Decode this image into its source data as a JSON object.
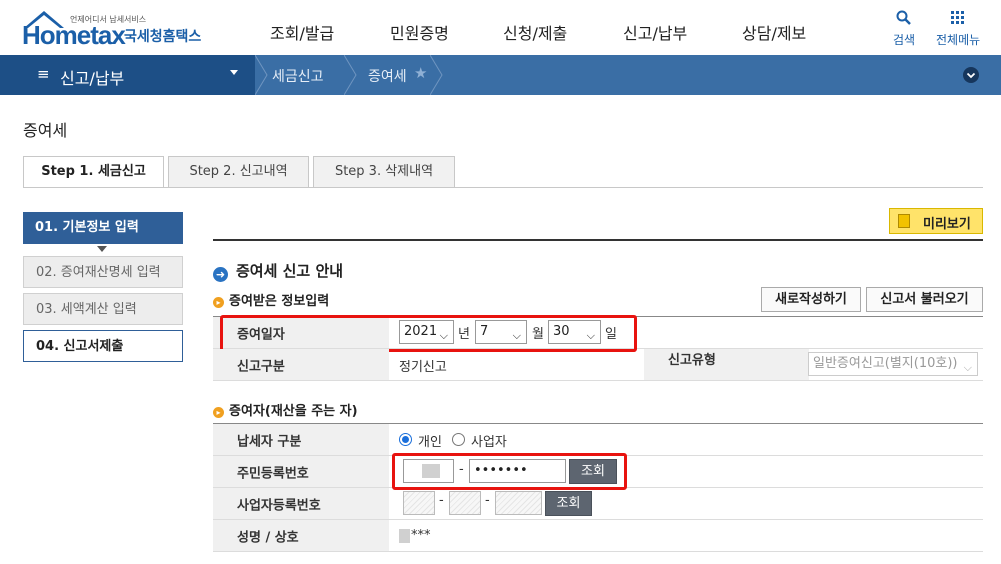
{
  "header": {
    "logo_small": "언제어디서 납세서비스",
    "logo_main": "Hometax",
    "logo_kr": "국세청홈택스",
    "gnb": [
      "조회/발급",
      "민원증명",
      "신청/제출",
      "신고/납부",
      "상담/제보"
    ],
    "search_label": "검색",
    "allmenu_label": "전체메뉴"
  },
  "navbar": {
    "menu_label": "신고/납부",
    "crumb1": "세금신고",
    "crumb2": "증여세"
  },
  "page": {
    "title": "증여세",
    "tabs": [
      "Step 1. 세금신고",
      "Step 2. 신고내역",
      "Step 3. 삭제내역"
    ]
  },
  "steps": [
    "01. 기본정보 입력",
    "02. 증여재산명세 입력",
    "03. 세액계산 입력",
    "04. 신고서제출"
  ],
  "preview_label": "미리보기",
  "section_title": "증여세 신고 안내",
  "recv": {
    "title": "증여받은 정보입력",
    "new_btn": "새로작성하기",
    "load_btn": "신고서 불러오기",
    "date_label": "증여일자",
    "year": "2021",
    "year_unit": "년",
    "month": "7",
    "month_unit": "월",
    "day": "30",
    "day_unit": "일",
    "type_label": "신고구분",
    "type_value": "정기신고",
    "kind_label": "신고유형",
    "kind_value": "일반증여신고(별지(10호))"
  },
  "giver": {
    "title": "증여자(재산을 주는 자)",
    "taxpayer_label": "납세자 구분",
    "opt_personal": "개인",
    "opt_business": "사업자",
    "rrn_label": "주민등록번호",
    "rrn_back": "•••••••",
    "lookup": "조회",
    "brn_label": "사업자등록번호",
    "brn_lookup": "조회",
    "name_label": "성명 / 상호",
    "name_value": "***"
  }
}
